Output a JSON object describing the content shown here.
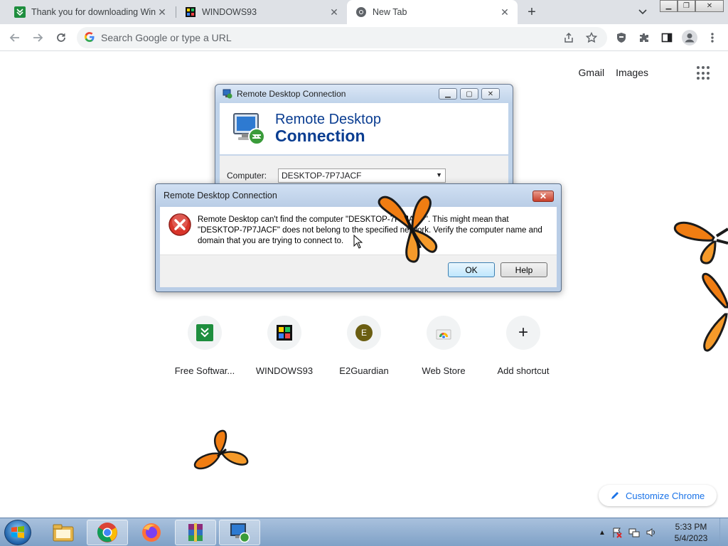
{
  "browser": {
    "tabs": [
      {
        "title": "Thank you for downloading WinR",
        "icon": "fosshub-icon"
      },
      {
        "title": "WINDOWS93",
        "icon": "windows93-icon"
      },
      {
        "title": "New Tab",
        "icon": "chrome-icon",
        "active": true
      }
    ],
    "omnibox_placeholder": "Search Google or type a URL"
  },
  "ntp": {
    "top_links": {
      "gmail": "Gmail",
      "images": "Images"
    },
    "shortcuts": [
      {
        "label": "Free Softwar...",
        "icon": "fosshub-icon"
      },
      {
        "label": "WINDOWS93",
        "icon": "windows93-icon"
      },
      {
        "label": "E2Guardian",
        "icon": "e2guardian-icon",
        "letter": "E"
      },
      {
        "label": "Web Store",
        "icon": "web-store-icon"
      },
      {
        "label": "Add shortcut",
        "icon": "plus-icon"
      }
    ],
    "customize_label": "Customize Chrome"
  },
  "rdc_window": {
    "title": "Remote Desktop Connection",
    "banner_line1": "Remote Desktop",
    "banner_line2": "Connection",
    "computer_label": "Computer:",
    "computer_value": "DESKTOP-7P7JACF"
  },
  "error_dialog": {
    "title": "Remote Desktop Connection",
    "message": "Remote Desktop can't find the computer \"DESKTOP-7P7JACF\". This might mean that \"DESKTOP-7P7JACF\" does not belong to the specified network.  Verify the computer name and domain that you are trying to connect to.",
    "ok_label": "OK",
    "help_label": "Help"
  },
  "taskbar": {
    "items": [
      "file-explorer-icon",
      "chrome-icon",
      "firefox-icon",
      "winrar-icon",
      "remote-desktop-icon"
    ],
    "clock_time": "5:33 PM",
    "clock_date": "5/4/2023"
  },
  "colors": {
    "accent": "#1a73e8",
    "rdc_blue": "#0a3d91",
    "error_red": "#c8402b",
    "fosshub_green": "#1e8e3e",
    "butterfly_orange": "#f07d12"
  }
}
